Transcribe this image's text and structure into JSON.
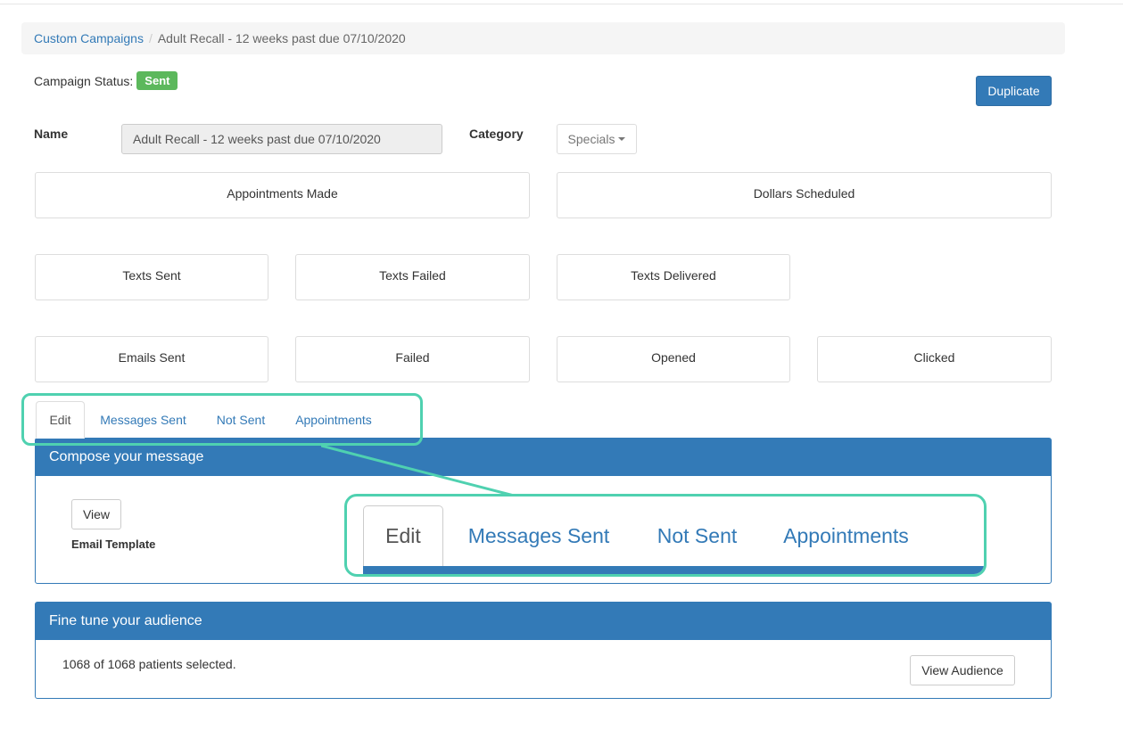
{
  "breadcrumb": {
    "link": "Custom Campaigns",
    "separator": "/",
    "current": "Adult Recall - 12 weeks past due 07/10/2020"
  },
  "status": {
    "label": "Campaign Status:",
    "badge": "Sent",
    "badge_color": "#5cb85c"
  },
  "actions": {
    "duplicate": "Duplicate"
  },
  "form": {
    "name_label": "Name",
    "name_value": "Adult Recall - 12 weeks past due 07/10/2020",
    "category_label": "Category",
    "category_value": "Specials"
  },
  "stats": {
    "appointments_made": {
      "label": "Appointments Made",
      "value": ""
    },
    "dollars_scheduled": {
      "label": "Dollars Scheduled",
      "value": ""
    },
    "texts_sent": {
      "label": "Texts Sent",
      "value": ""
    },
    "texts_failed": {
      "label": "Texts Failed",
      "value": ""
    },
    "texts_delivered": {
      "label": "Texts Delivered",
      "value": ""
    },
    "emails_sent": {
      "label": "Emails Sent",
      "value": ""
    },
    "failed": {
      "label": "Failed",
      "value": ""
    },
    "opened": {
      "label": "Opened",
      "value": ""
    },
    "clicked": {
      "label": "Clicked",
      "value": ""
    }
  },
  "tabs": [
    {
      "label": "Edit"
    },
    {
      "label": "Messages Sent"
    },
    {
      "label": "Not Sent"
    },
    {
      "label": "Appointments"
    }
  ],
  "compose": {
    "title": "Compose your message",
    "view_button": "View",
    "template_label": "Email Template"
  },
  "audience": {
    "title": "Fine tune your audience",
    "summary": "1068 of 1068 patients selected.",
    "view_button": "View Audience"
  },
  "colors": {
    "primary": "#337ab7",
    "highlight": "#4fd1b0"
  }
}
